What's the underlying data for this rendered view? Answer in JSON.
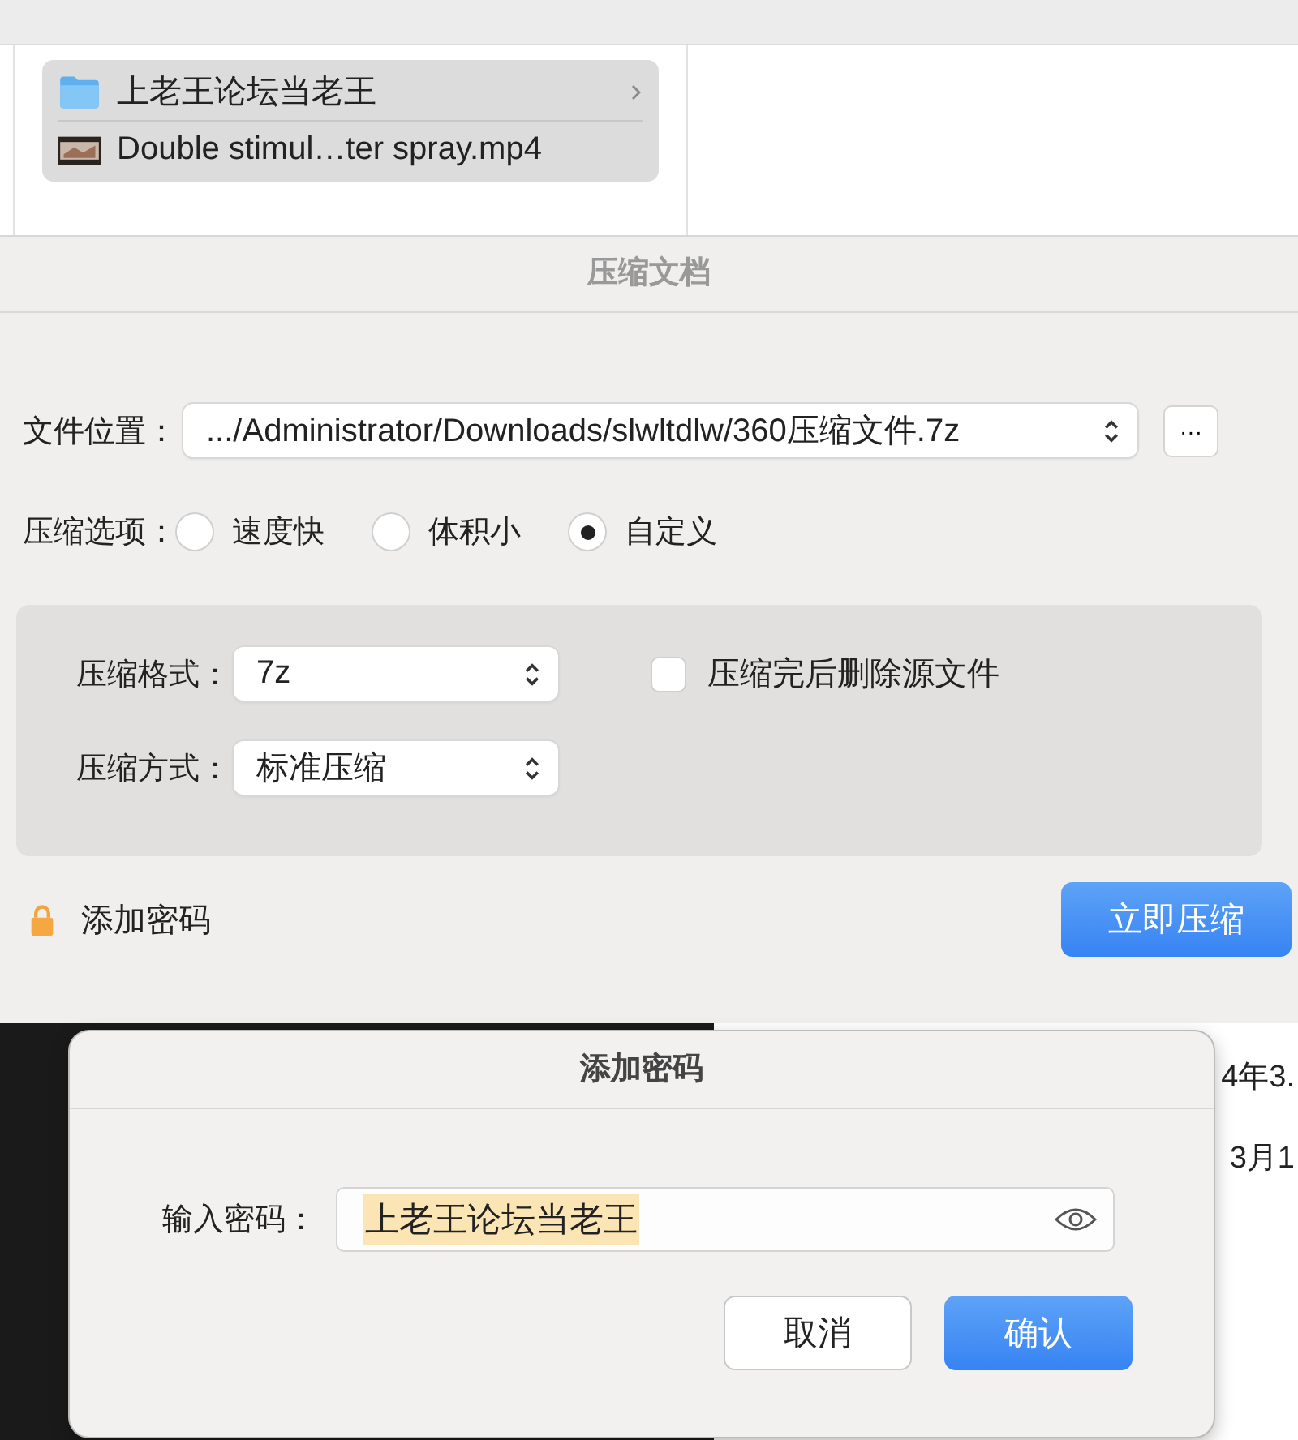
{
  "finder": {
    "items": [
      {
        "kind": "folder",
        "name": "上老王论坛当老王"
      },
      {
        "kind": "video",
        "name": "Double stimul…ter spray.mp4"
      }
    ]
  },
  "compress_sheet": {
    "title": "压缩文档",
    "location": {
      "label": "文件位置：",
      "value": ".../Administrator/Downloads/slwltdlw/360压缩文件.7z",
      "browse": "···"
    },
    "options": {
      "label": "压缩选项：",
      "choices": [
        {
          "label": "速度快",
          "selected": false
        },
        {
          "label": "体积小",
          "selected": false
        },
        {
          "label": "自定义",
          "selected": true
        }
      ]
    },
    "format": {
      "label": "压缩格式：",
      "value": "7z"
    },
    "method": {
      "label": "压缩方式：",
      "value": "标准压缩"
    },
    "delete_source": {
      "label": "压缩完后删除源文件",
      "checked": false
    },
    "add_password": "添加密码",
    "compress_button": "立即压缩"
  },
  "background": {
    "dates": [
      "4年3.",
      "3月1"
    ]
  },
  "password_dialog": {
    "title": "添加密码",
    "label": "输入密码：",
    "value": "上老王论坛当老王",
    "value_selected": true,
    "buttons": [
      {
        "label": "取消",
        "kind": "default"
      },
      {
        "label": "确认",
        "kind": "primary"
      }
    ]
  }
}
